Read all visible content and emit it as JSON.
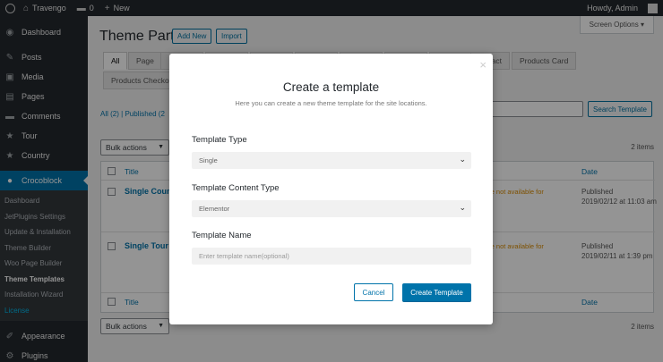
{
  "adminbar": {
    "site_name": "Travengo",
    "comments_count": "0",
    "new_label": "New",
    "howdy": "Howdy, Admin"
  },
  "sidebar": {
    "items_top": [
      {
        "label": "Dashboard",
        "icon": "dashboard-icon",
        "glyph": "◉"
      },
      {
        "label": "Posts",
        "icon": "pin-icon",
        "glyph": "✎"
      },
      {
        "label": "Media",
        "icon": "media-icon",
        "glyph": "▣"
      },
      {
        "label": "Pages",
        "icon": "pages-icon",
        "glyph": "▤"
      },
      {
        "label": "Comments",
        "icon": "comments-icon",
        "glyph": "▬"
      },
      {
        "label": "Tour",
        "icon": "star-icon",
        "glyph": "★"
      },
      {
        "label": "Country",
        "icon": "star-icon",
        "glyph": "★"
      }
    ],
    "crocoblock_label": "Crocoblock",
    "submenu": [
      "Dashboard",
      "JetPlugins Settings",
      "Update & Installation",
      "Theme Builder",
      "Woo Page Builder",
      "Theme Templates",
      "Installation Wizard",
      "License"
    ],
    "items_bottom": [
      {
        "label": "Appearance",
        "icon": "appearance-icon",
        "glyph": "✐"
      },
      {
        "label": "Plugins",
        "icon": "plugins-icon",
        "glyph": "⚙"
      }
    ]
  },
  "main": {
    "page_title": "Theme Parts",
    "add_new": "Add New",
    "import": "Import",
    "screen_options": "Screen Options ▾",
    "tabs": [
      "All",
      "Page",
      "act",
      "Products Card",
      "Products Checko"
    ],
    "views_all": "All (2) |",
    "views_published": "Published (2",
    "search_button": "Search Template",
    "bulk_actions": "Bulk actions",
    "items_count": "2 items",
    "col_title": "Title",
    "col_date": "Date",
    "rows": [
      {
        "title": "Single Count",
        "warning": "are not available for",
        "date_status": "Published",
        "date_value": "2019/02/12 at 11:03 am"
      },
      {
        "title": "Single Tour -",
        "warning": "are not available for",
        "date_status": "Published",
        "date_value": "2019/02/11 at 1:39 pm"
      }
    ]
  },
  "modal": {
    "close": "×",
    "title": "Create a template",
    "description": "Here you can create a new theme template for the site locations.",
    "template_type_label": "Template Type",
    "template_type_value": "Single",
    "content_type_label": "Template Content Type",
    "content_type_value": "Elementor",
    "template_name_label": "Template Name",
    "template_name_placeholder": "Enter template name(optional)",
    "cancel": "Cancel",
    "create": "Create Template"
  },
  "colors": {
    "primary": "#0073aa",
    "admin_bg": "#23282d"
  }
}
